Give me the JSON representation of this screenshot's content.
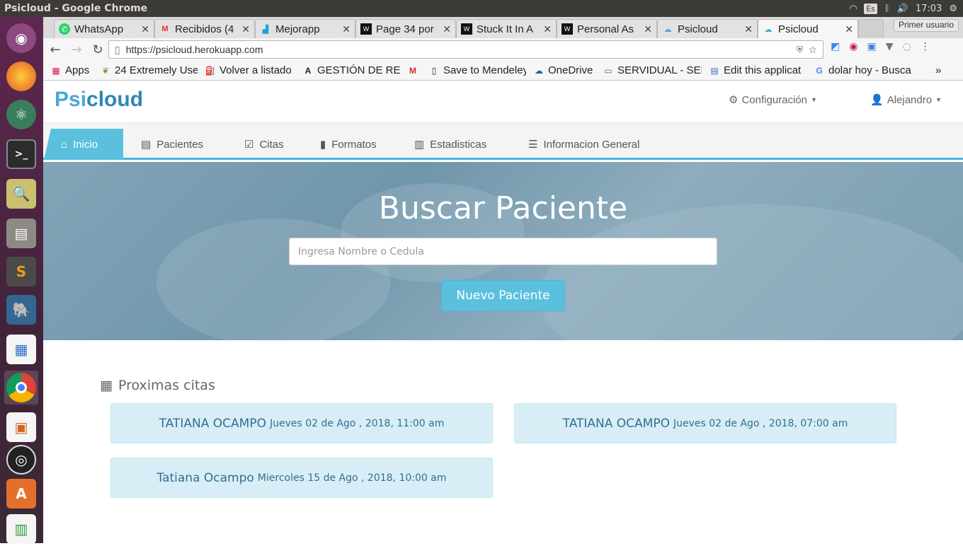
{
  "system": {
    "window_title": "Psicloud - Google Chrome",
    "keyboard_layout": "Es",
    "clock": "17:03"
  },
  "launcher": {
    "items": [
      "ubuntu-dash",
      "firefox",
      "atom",
      "terminal",
      "search-tool",
      "files",
      "sublime-text",
      "pgadmin",
      "libreoffice-writer",
      "chrome",
      "impress",
      "obs",
      "installer",
      "calc"
    ]
  },
  "browser": {
    "tabs": [
      {
        "label": "WhatsApp",
        "icon": "whatsapp-icon"
      },
      {
        "label": "Recibidos (4",
        "icon": "gmail-icon"
      },
      {
        "label": "Mejorapp",
        "icon": "chart-icon"
      },
      {
        "label": "Page 34 por",
        "icon": "wattpad-icon"
      },
      {
        "label": "Stuck It In A",
        "icon": "wattpad-icon"
      },
      {
        "label": "Personal As",
        "icon": "wattpad-icon"
      },
      {
        "label": "Psicloud",
        "icon": "psicloud-icon"
      },
      {
        "label": "Psicloud",
        "icon": "psicloud-icon",
        "active": true
      }
    ],
    "profile_label": "Primer usuario",
    "url": "https://psicloud.herokuapp.com",
    "bookmarks": [
      {
        "label": "Apps",
        "icon": "apps-grid-icon"
      },
      {
        "label": "24 Extremely Use",
        "icon": "leaf-icon"
      },
      {
        "label": "Volver a listado",
        "icon": "hat-icon"
      },
      {
        "label": "GESTIÓN DE REC",
        "icon": "letter-a-icon"
      },
      {
        "label": "",
        "icon": "gmail-icon"
      },
      {
        "label": "Save to Mendeley",
        "icon": "page-icon"
      },
      {
        "label": "OneDrive",
        "icon": "cloud-icon"
      },
      {
        "label": "SERVIDUAL - SER",
        "icon": "window-icon"
      },
      {
        "label": "Edit this applicat",
        "icon": "form-icon"
      },
      {
        "label": "dolar hoy - Busca",
        "icon": "google-icon"
      }
    ],
    "more_bookmarks": "»"
  },
  "app": {
    "logo": {
      "prefix": "Psi",
      "suffix": "cloud"
    },
    "config_menu": "Configuración",
    "user_menu": "Alejandro",
    "nav_tabs": [
      {
        "label": "Inicio",
        "icon": "home-icon",
        "active": true
      },
      {
        "label": "Pacientes",
        "icon": "id-card-icon"
      },
      {
        "label": "Citas",
        "icon": "calendar-check-icon"
      },
      {
        "label": "Formatos",
        "icon": "document-icon"
      },
      {
        "label": "Estadisticas",
        "icon": "bar-chart-icon"
      },
      {
        "label": "Informacion General",
        "icon": "list-icon"
      }
    ],
    "hero": {
      "title": "Buscar Paciente",
      "search_placeholder": "Ingresa Nombre o Cedula",
      "new_patient_label": "Nuevo Paciente"
    },
    "appointments": {
      "heading": "Proximas citas",
      "items": [
        {
          "name": "TATIANA OCAMPO",
          "date": "Jueves 02 de Ago , 2018, 11:00 am"
        },
        {
          "name": "TATIANA OCAMPO",
          "date": "Jueves 02 de Ago , 2018, 07:00 am"
        },
        {
          "name": "Tatiana Ocampo",
          "date": "Miercoles 15 de Ago , 2018, 10:00 am"
        }
      ]
    }
  }
}
